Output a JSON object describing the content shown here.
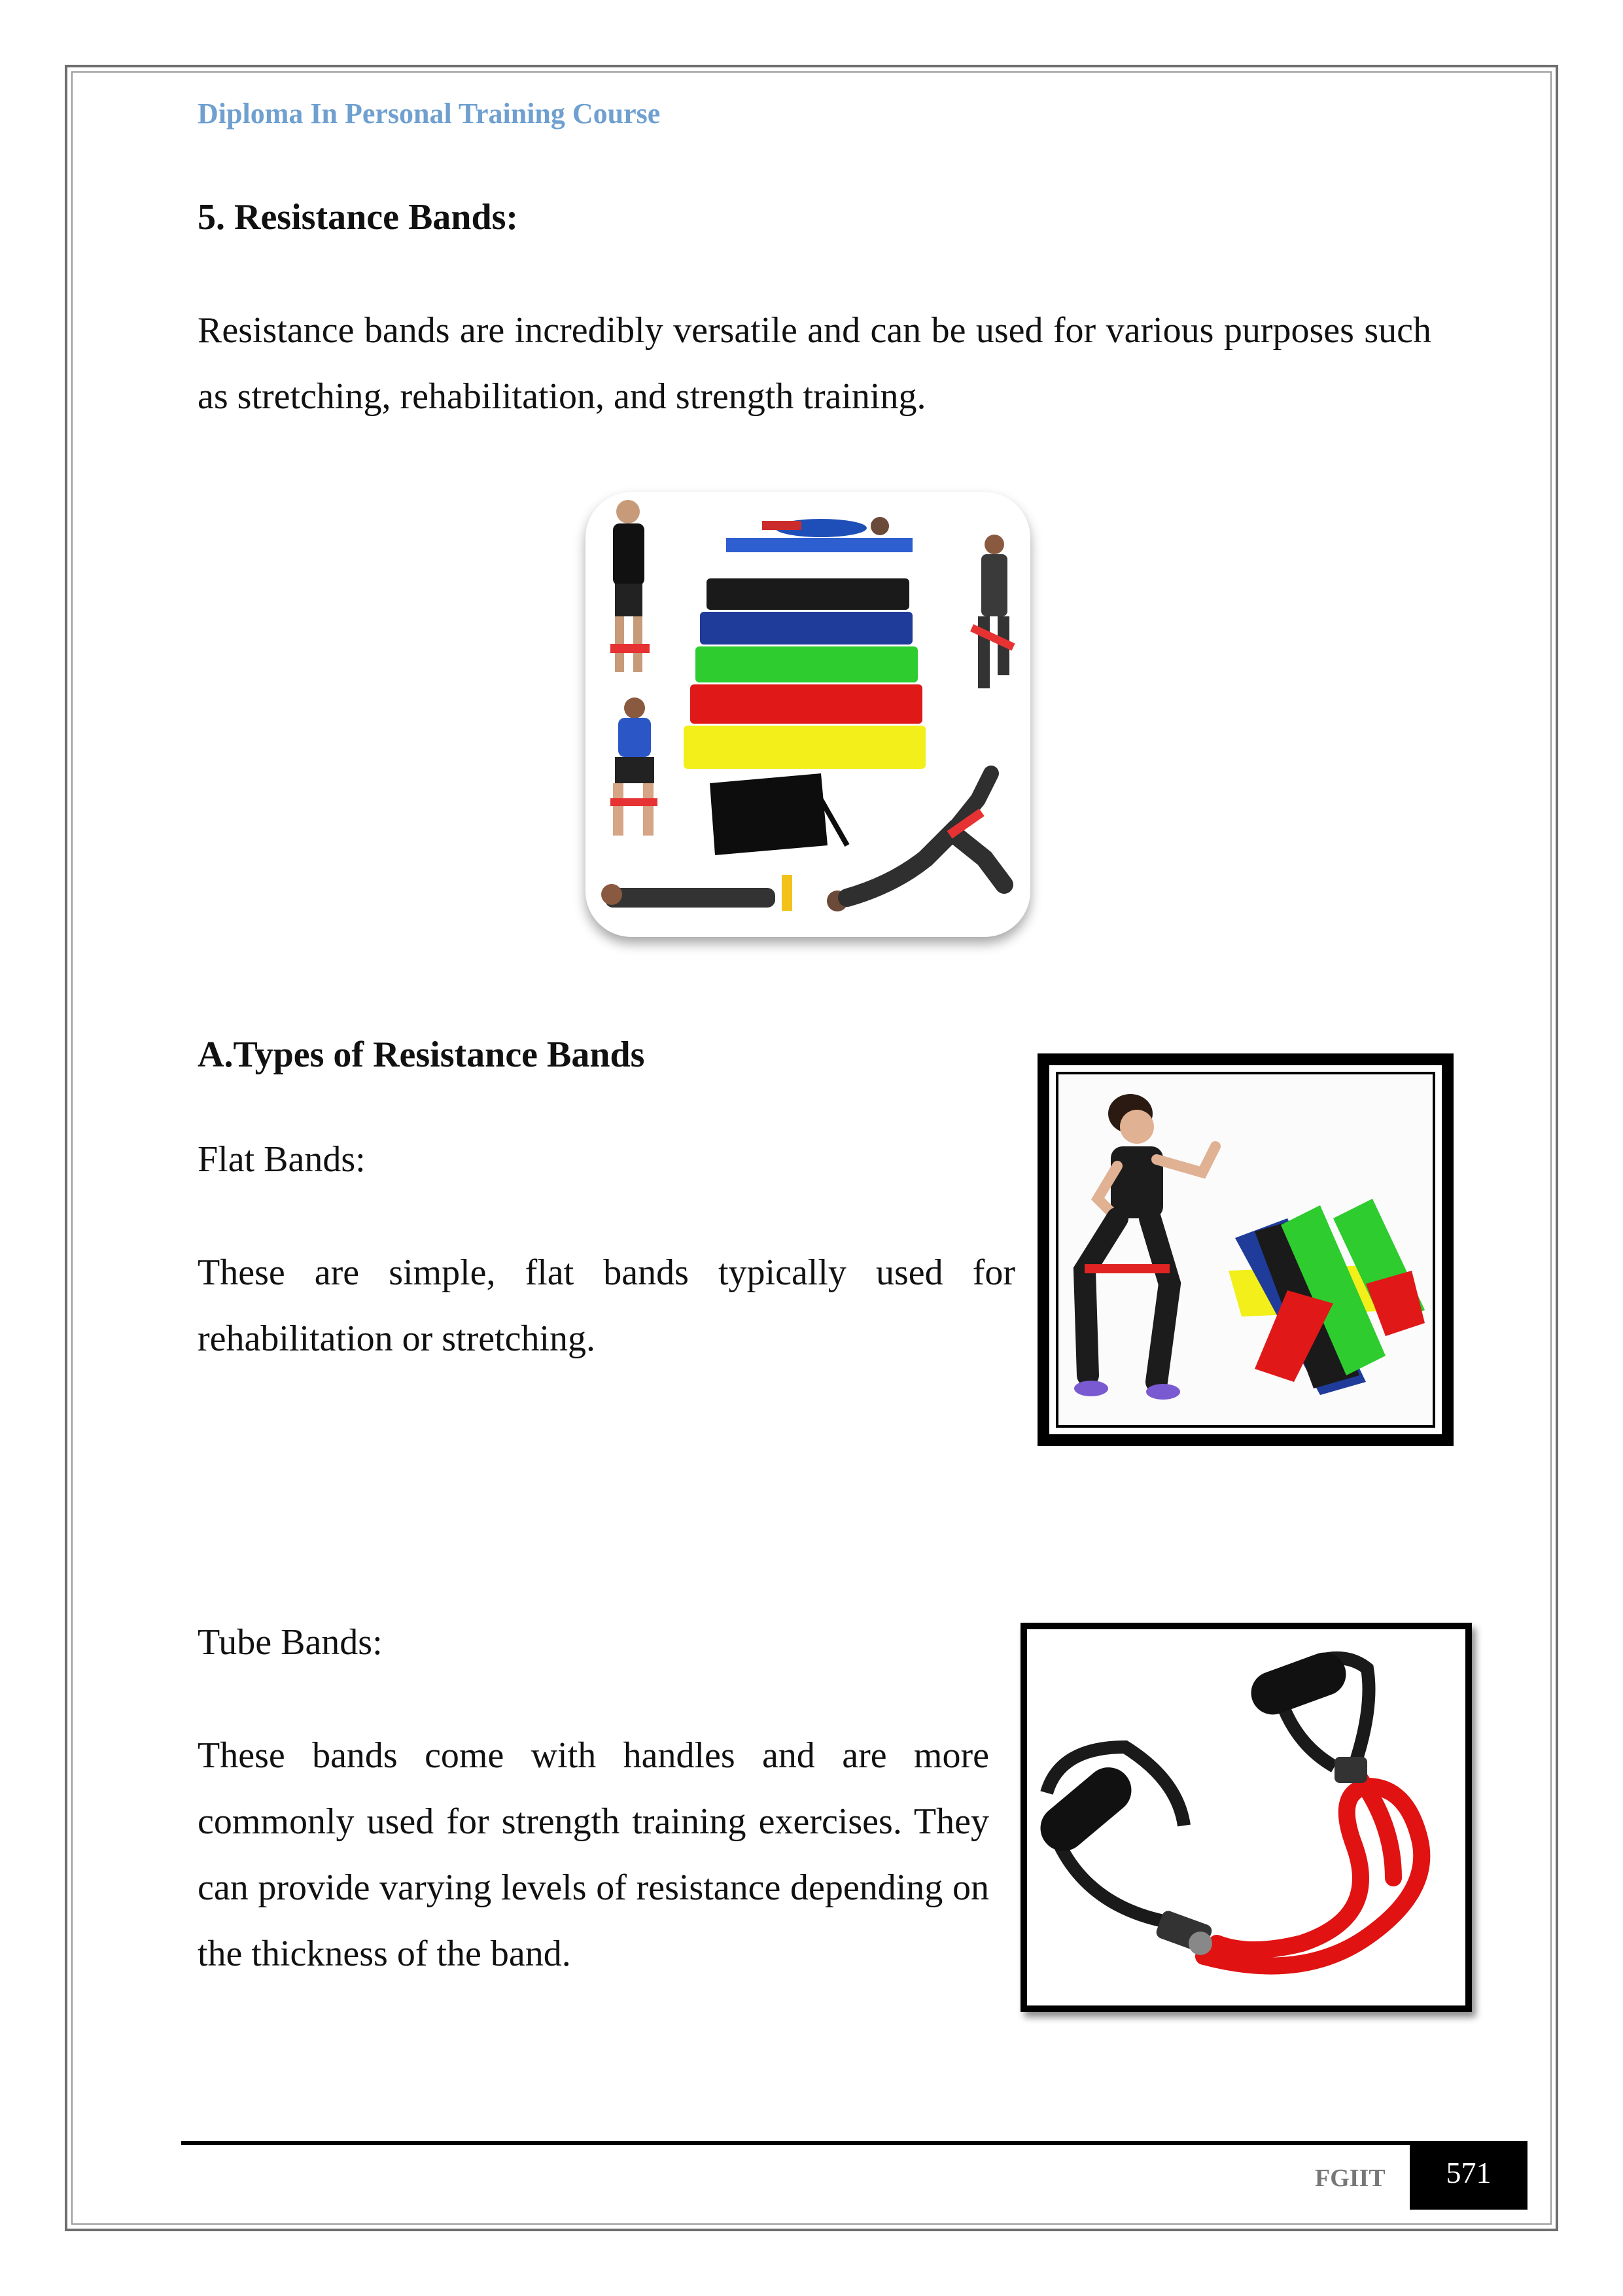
{
  "header": {
    "course_title": "Diploma In Personal Training Course"
  },
  "section": {
    "heading": "5. Resistance Bands:",
    "intro": "Resistance bands are incredibly versatile and can be used for various purposes such as stretching, rehabilitation, and strength training."
  },
  "types": {
    "heading": "A.Types of Resistance Bands",
    "flat": {
      "label": "Flat Bands:",
      "text": "These are simple, flat bands typically used for rehabilitation or stretching."
    },
    "tube": {
      "label": "Tube Bands:",
      "text": "These bands come with handles and are more commonly used for strength training exercises. They can provide varying levels of resistance depending on the thickness of the band."
    }
  },
  "footer": {
    "org": "FGIIT",
    "page_number": "571"
  },
  "colors": {
    "header_blue": "#6fa0d0",
    "band_black": "#1a1a1a",
    "band_blue": "#1f3c9a",
    "band_green": "#2ecc2e",
    "band_red": "#e01818",
    "band_yellow": "#f2ef1a"
  }
}
